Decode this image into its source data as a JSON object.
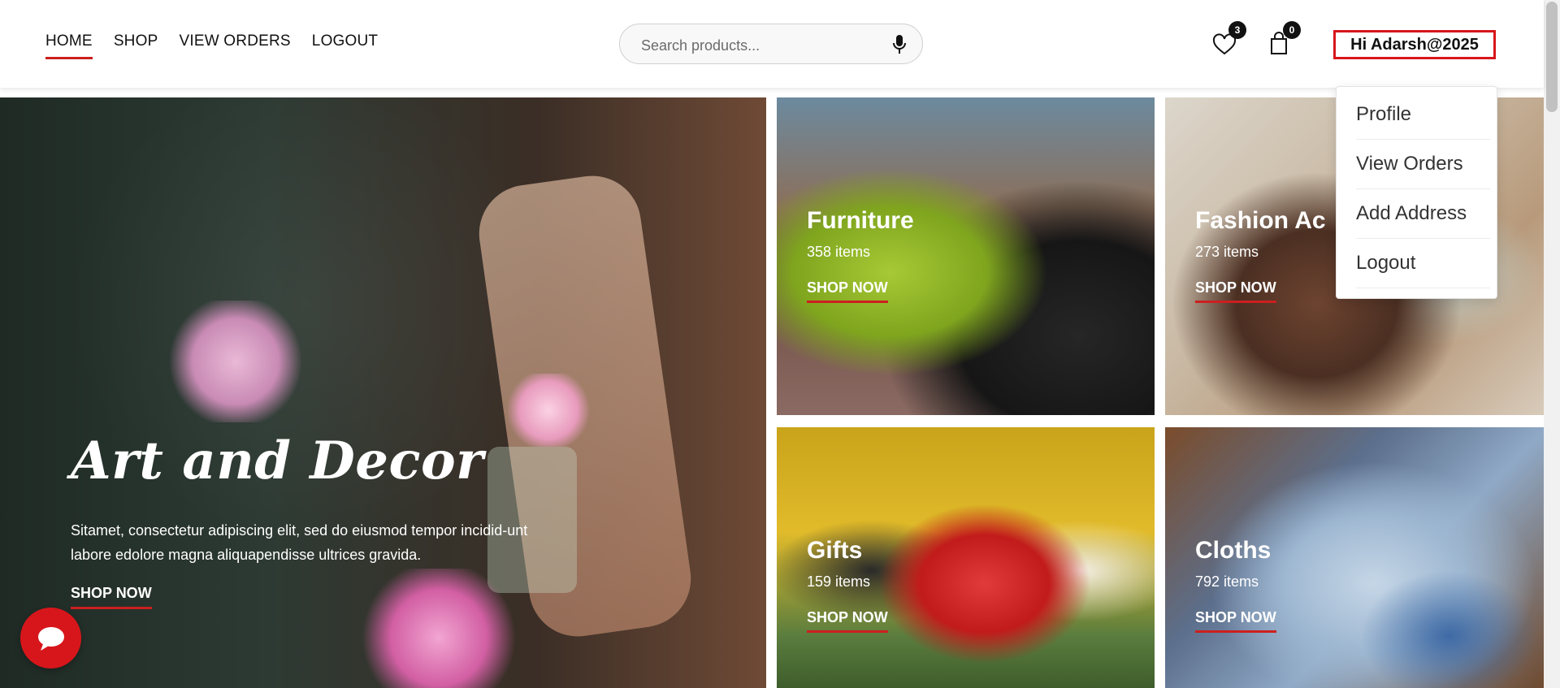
{
  "nav": {
    "items": [
      {
        "label": "HOME",
        "active": true
      },
      {
        "label": "SHOP"
      },
      {
        "label": "VIEW ORDERS"
      },
      {
        "label": "LOGOUT"
      }
    ]
  },
  "search": {
    "placeholder": "Search products...",
    "icon": "mic-icon"
  },
  "wishlist": {
    "count": "3",
    "icon": "heart-icon"
  },
  "cart": {
    "count": "0",
    "icon": "shopping-bag-icon"
  },
  "user": {
    "greeting": "Hi Adarsh@2025"
  },
  "dropdown": {
    "items": [
      "Profile",
      "View Orders",
      "Add Address",
      "Logout"
    ]
  },
  "hero": {
    "title": "Art and Decor",
    "text": "Sitamet, consectetur adipiscing elit, sed do eiusmod tempor incidid-unt labore edolore magna aliquapendisse ultrices gravida.",
    "cta": "SHOP NOW"
  },
  "categories": [
    {
      "title": "Furniture",
      "count": "358 items",
      "cta": "SHOP NOW"
    },
    {
      "title": "Fashion Ac",
      "count": "273 items",
      "cta": "SHOP NOW"
    },
    {
      "title": "Gifts",
      "count": "159 items",
      "cta": "SHOP NOW"
    },
    {
      "title": "Cloths",
      "count": "792 items",
      "cta": "SHOP NOW"
    }
  ],
  "colors": {
    "accent": "#d7161b",
    "underline": "#cc1f1f"
  },
  "chat": {
    "icon": "chat-bubble-icon"
  }
}
